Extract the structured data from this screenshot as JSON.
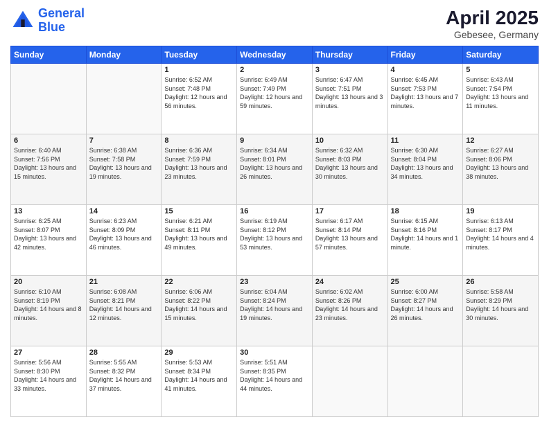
{
  "header": {
    "logo_line1": "General",
    "logo_line2": "Blue",
    "title": "April 2025",
    "subtitle": "Gebesee, Germany"
  },
  "days_of_week": [
    "Sunday",
    "Monday",
    "Tuesday",
    "Wednesday",
    "Thursday",
    "Friday",
    "Saturday"
  ],
  "weeks": [
    [
      {
        "day": "",
        "info": ""
      },
      {
        "day": "",
        "info": ""
      },
      {
        "day": "1",
        "sunrise": "6:52 AM",
        "sunset": "7:48 PM",
        "daylight": "12 hours and 56 minutes."
      },
      {
        "day": "2",
        "sunrise": "6:49 AM",
        "sunset": "7:49 PM",
        "daylight": "12 hours and 59 minutes."
      },
      {
        "day": "3",
        "sunrise": "6:47 AM",
        "sunset": "7:51 PM",
        "daylight": "13 hours and 3 minutes."
      },
      {
        "day": "4",
        "sunrise": "6:45 AM",
        "sunset": "7:53 PM",
        "daylight": "13 hours and 7 minutes."
      },
      {
        "day": "5",
        "sunrise": "6:43 AM",
        "sunset": "7:54 PM",
        "daylight": "13 hours and 11 minutes."
      }
    ],
    [
      {
        "day": "6",
        "sunrise": "6:40 AM",
        "sunset": "7:56 PM",
        "daylight": "13 hours and 15 minutes."
      },
      {
        "day": "7",
        "sunrise": "6:38 AM",
        "sunset": "7:58 PM",
        "daylight": "13 hours and 19 minutes."
      },
      {
        "day": "8",
        "sunrise": "6:36 AM",
        "sunset": "7:59 PM",
        "daylight": "13 hours and 23 minutes."
      },
      {
        "day": "9",
        "sunrise": "6:34 AM",
        "sunset": "8:01 PM",
        "daylight": "13 hours and 26 minutes."
      },
      {
        "day": "10",
        "sunrise": "6:32 AM",
        "sunset": "8:03 PM",
        "daylight": "13 hours and 30 minutes."
      },
      {
        "day": "11",
        "sunrise": "6:30 AM",
        "sunset": "8:04 PM",
        "daylight": "13 hours and 34 minutes."
      },
      {
        "day": "12",
        "sunrise": "6:27 AM",
        "sunset": "8:06 PM",
        "daylight": "13 hours and 38 minutes."
      }
    ],
    [
      {
        "day": "13",
        "sunrise": "6:25 AM",
        "sunset": "8:07 PM",
        "daylight": "13 hours and 42 minutes."
      },
      {
        "day": "14",
        "sunrise": "6:23 AM",
        "sunset": "8:09 PM",
        "daylight": "13 hours and 46 minutes."
      },
      {
        "day": "15",
        "sunrise": "6:21 AM",
        "sunset": "8:11 PM",
        "daylight": "13 hours and 49 minutes."
      },
      {
        "day": "16",
        "sunrise": "6:19 AM",
        "sunset": "8:12 PM",
        "daylight": "13 hours and 53 minutes."
      },
      {
        "day": "17",
        "sunrise": "6:17 AM",
        "sunset": "8:14 PM",
        "daylight": "13 hours and 57 minutes."
      },
      {
        "day": "18",
        "sunrise": "6:15 AM",
        "sunset": "8:16 PM",
        "daylight": "14 hours and 1 minute."
      },
      {
        "day": "19",
        "sunrise": "6:13 AM",
        "sunset": "8:17 PM",
        "daylight": "14 hours and 4 minutes."
      }
    ],
    [
      {
        "day": "20",
        "sunrise": "6:10 AM",
        "sunset": "8:19 PM",
        "daylight": "14 hours and 8 minutes."
      },
      {
        "day": "21",
        "sunrise": "6:08 AM",
        "sunset": "8:21 PM",
        "daylight": "14 hours and 12 minutes."
      },
      {
        "day": "22",
        "sunrise": "6:06 AM",
        "sunset": "8:22 PM",
        "daylight": "14 hours and 15 minutes."
      },
      {
        "day": "23",
        "sunrise": "6:04 AM",
        "sunset": "8:24 PM",
        "daylight": "14 hours and 19 minutes."
      },
      {
        "day": "24",
        "sunrise": "6:02 AM",
        "sunset": "8:26 PM",
        "daylight": "14 hours and 23 minutes."
      },
      {
        "day": "25",
        "sunrise": "6:00 AM",
        "sunset": "8:27 PM",
        "daylight": "14 hours and 26 minutes."
      },
      {
        "day": "26",
        "sunrise": "5:58 AM",
        "sunset": "8:29 PM",
        "daylight": "14 hours and 30 minutes."
      }
    ],
    [
      {
        "day": "27",
        "sunrise": "5:56 AM",
        "sunset": "8:30 PM",
        "daylight": "14 hours and 33 minutes."
      },
      {
        "day": "28",
        "sunrise": "5:55 AM",
        "sunset": "8:32 PM",
        "daylight": "14 hours and 37 minutes."
      },
      {
        "day": "29",
        "sunrise": "5:53 AM",
        "sunset": "8:34 PM",
        "daylight": "14 hours and 41 minutes."
      },
      {
        "day": "30",
        "sunrise": "5:51 AM",
        "sunset": "8:35 PM",
        "daylight": "14 hours and 44 minutes."
      },
      {
        "day": "",
        "info": ""
      },
      {
        "day": "",
        "info": ""
      },
      {
        "day": "",
        "info": ""
      }
    ]
  ]
}
